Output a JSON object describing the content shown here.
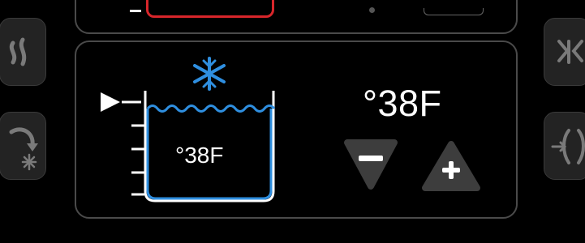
{
  "target_temp": "°38F",
  "current_temp": "°38F",
  "icons": {
    "left_top": "heat-waves-icon",
    "left_bottom": "cool-cycle-icon",
    "right_top": "defrost-icon",
    "right_bottom": "fan-icon",
    "tank_indicator": "snowflake-icon",
    "level_pointer": "play-pointer-icon",
    "decrease": "minus-icon",
    "increase": "plus-icon"
  },
  "colors": {
    "accent_blue": "#2f8fe0",
    "alert_red": "#d8262b",
    "panel_border": "#4a4a4a",
    "button_gray": "#3d3d3d"
  }
}
